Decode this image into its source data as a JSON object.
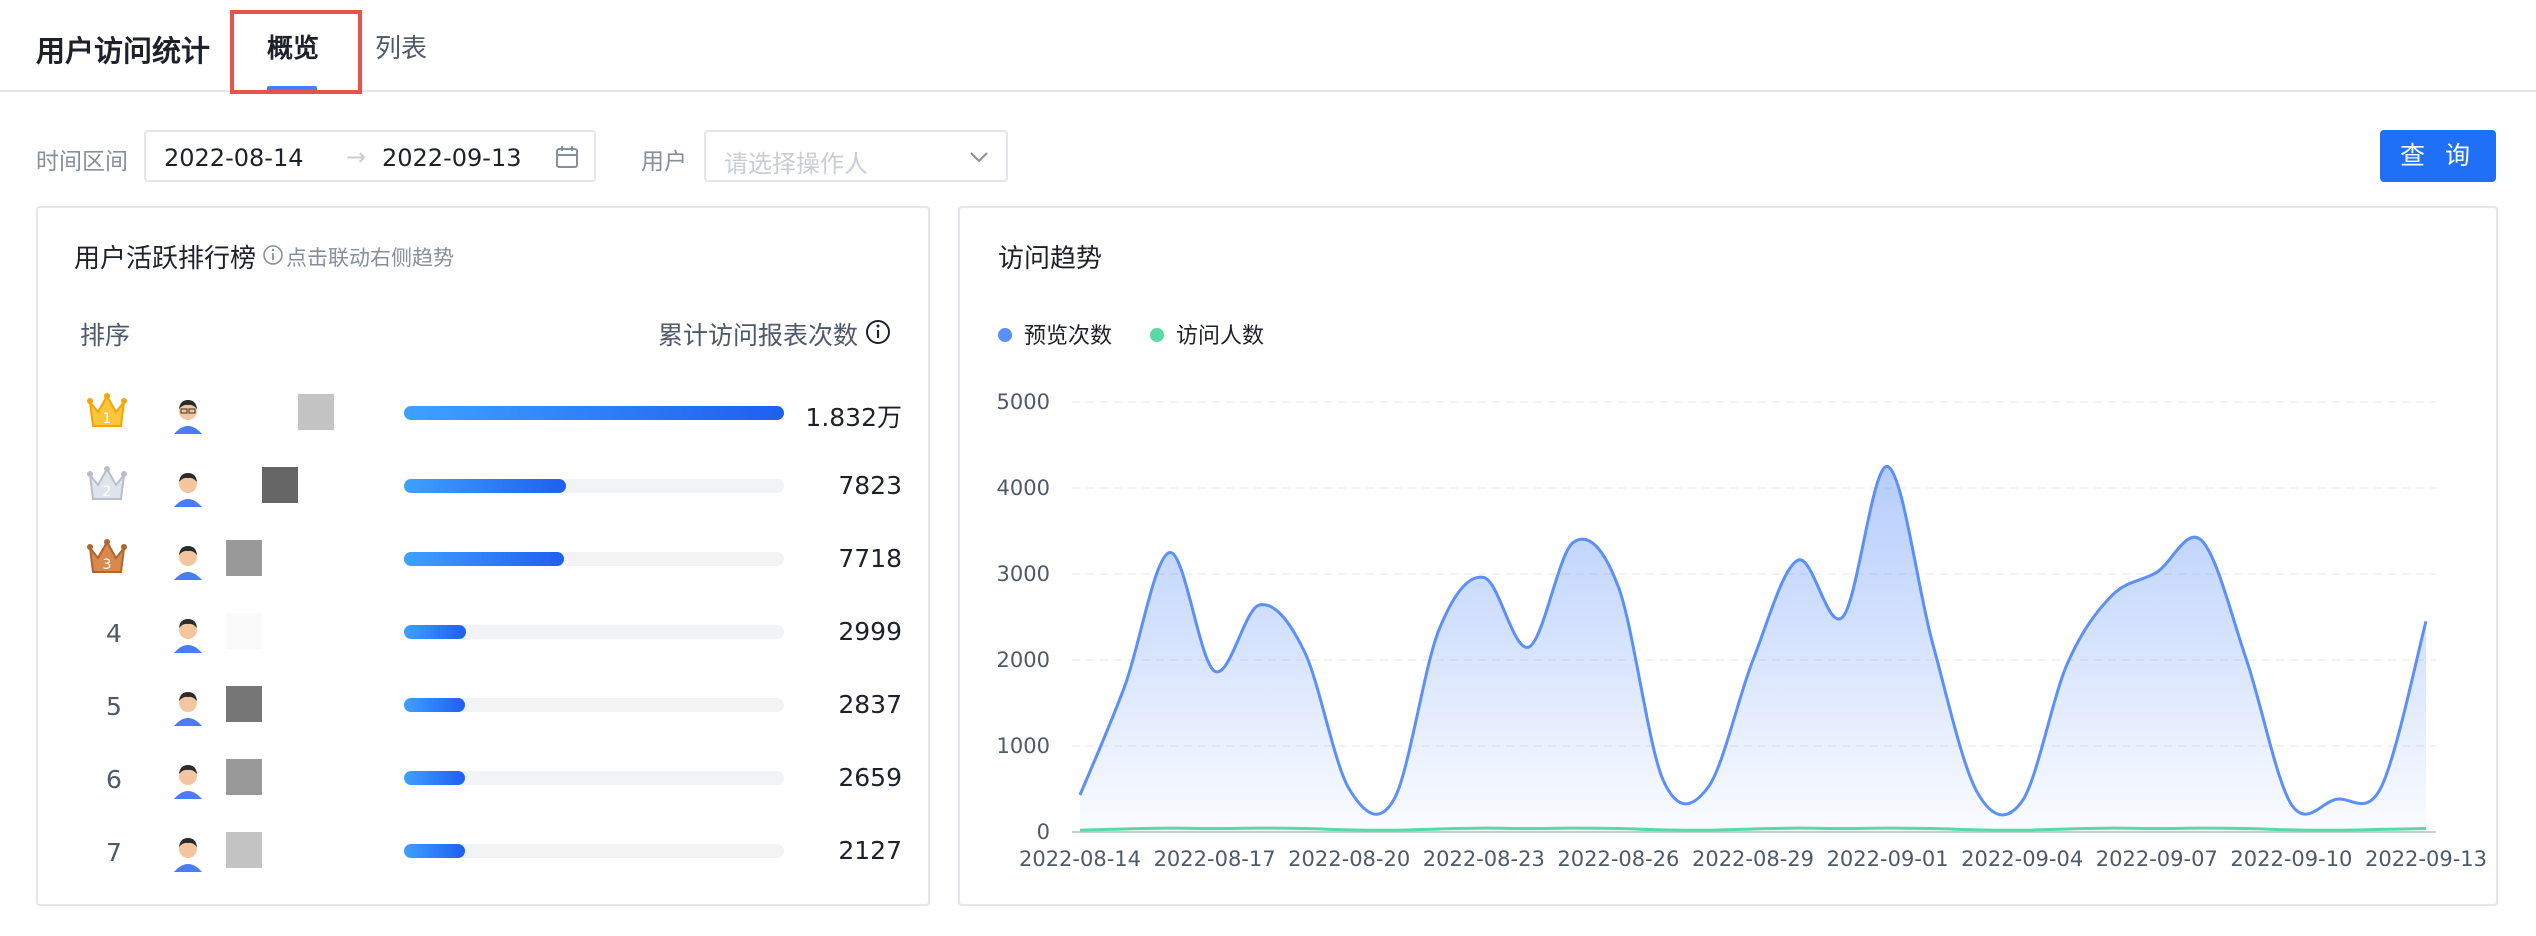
{
  "header": {
    "app_title": "用户访问统计",
    "tabs": [
      {
        "label": "概览",
        "active": true
      },
      {
        "label": "列表",
        "active": false
      }
    ]
  },
  "filters": {
    "time_label": "时间区间",
    "start_date": "2022-08-14",
    "end_date": "2022-09-13",
    "separator": "→",
    "user_label": "用户",
    "user_placeholder": "请选择操作人",
    "query_label": "查 询"
  },
  "ranking": {
    "title": "用户活跃排行榜",
    "hint": "点击联动右侧趋势",
    "col_rank": "排序",
    "col_value": "累计访问报表次数",
    "max_value": 18320,
    "rows": [
      {
        "rank": "1",
        "crown": "gold",
        "value": 18320,
        "value_text": "1.832万",
        "name_shade": "#c4c4c4",
        "name_offset": 0.0
      },
      {
        "rank": "2",
        "crown": "silver",
        "value": 7823,
        "value_text": "7823",
        "name_shade": "#666666",
        "name_offset": 1.0
      },
      {
        "rank": "3",
        "crown": "bronze",
        "value": 7718,
        "value_text": "7718",
        "name_shade": "#999999",
        "name_offset": 2.0
      },
      {
        "rank": "4",
        "crown": "",
        "value": 2999,
        "value_text": "2999",
        "name_shade": "#fafafa",
        "name_offset": 2.0
      },
      {
        "rank": "5",
        "crown": "",
        "value": 2837,
        "value_text": "2837",
        "name_shade": "#777777",
        "name_offset": 2.0
      },
      {
        "rank": "6",
        "crown": "",
        "value": 2659,
        "value_text": "2659",
        "name_shade": "#999999",
        "name_offset": 2.0
      },
      {
        "rank": "7",
        "crown": "",
        "value": 2127,
        "value_text": "2127",
        "name_shade": "#c4c4c4",
        "name_offset": 2.0
      }
    ]
  },
  "trend": {
    "title": "访问趋势"
  },
  "colors": {
    "primary": "#1f6ff7",
    "views_line": "#5b8ff9",
    "visitors_line": "#5ad8a6",
    "tab_highlight": "#e5534b"
  },
  "chart_data": {
    "type": "area",
    "x": [
      "2022-08-14",
      "2022-08-15",
      "2022-08-16",
      "2022-08-17",
      "2022-08-18",
      "2022-08-19",
      "2022-08-20",
      "2022-08-21",
      "2022-08-22",
      "2022-08-23",
      "2022-08-24",
      "2022-08-25",
      "2022-08-26",
      "2022-08-27",
      "2022-08-28",
      "2022-08-29",
      "2022-08-30",
      "2022-08-31",
      "2022-09-01",
      "2022-09-02",
      "2022-09-03",
      "2022-09-04",
      "2022-09-05",
      "2022-09-06",
      "2022-09-07",
      "2022-09-08",
      "2022-09-09",
      "2022-09-10",
      "2022-09-11",
      "2022-09-12",
      "2022-09-13"
    ],
    "x_ticks": [
      "2022-08-14",
      "2022-08-17",
      "2022-08-20",
      "2022-08-23",
      "2022-08-26",
      "2022-08-29",
      "2022-09-01",
      "2022-09-04",
      "2022-09-07",
      "2022-09-10",
      "2022-09-13"
    ],
    "series": [
      {
        "name": "预览次数",
        "color": "#5b8ff9",
        "values": [
          430,
          1700,
          3250,
          1870,
          2640,
          2100,
          500,
          380,
          2350,
          2960,
          2150,
          3370,
          2850,
          600,
          520,
          2000,
          3160,
          2500,
          4250,
          2200,
          460,
          360,
          1950,
          2750,
          3020,
          3390,
          2000,
          320,
          380,
          520,
          2450
        ]
      },
      {
        "name": "访问人数",
        "color": "#5ad8a6",
        "values": [
          20,
          35,
          45,
          40,
          45,
          40,
          25,
          20,
          35,
          45,
          40,
          45,
          40,
          25,
          20,
          35,
          45,
          40,
          45,
          40,
          25,
          20,
          35,
          45,
          40,
          45,
          40,
          25,
          20,
          30,
          40
        ]
      }
    ],
    "ylim": [
      0,
      5000
    ],
    "y_ticks": [
      0,
      1000,
      2000,
      3000,
      4000,
      5000
    ],
    "grid": true,
    "legend": "top-left",
    "xlabel": "",
    "ylabel": ""
  }
}
